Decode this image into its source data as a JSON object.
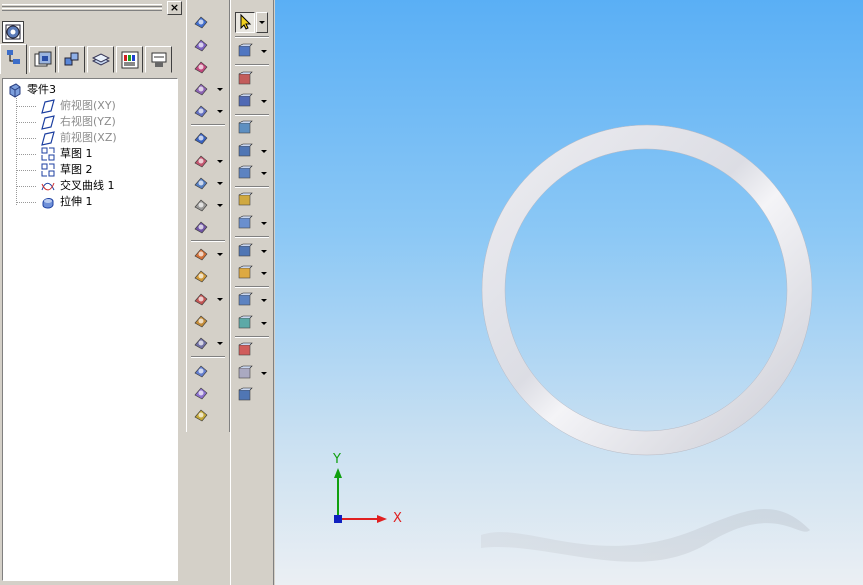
{
  "panel": {
    "close_label": "×",
    "tabs": [
      {
        "name": "feature-tree"
      },
      {
        "name": "properties"
      },
      {
        "name": "assembly"
      },
      {
        "name": "layers"
      },
      {
        "name": "render"
      },
      {
        "name": "display"
      }
    ]
  },
  "tree": {
    "root": "零件3",
    "items": [
      {
        "label": "俯视图(XY)",
        "icon": "plane-icon",
        "disabled": true
      },
      {
        "label": "右视图(YZ)",
        "icon": "plane-icon",
        "disabled": true
      },
      {
        "label": "前视图(XZ)",
        "icon": "plane-icon",
        "disabled": true
      },
      {
        "label": "草图 1",
        "icon": "sketch-icon",
        "disabled": false
      },
      {
        "label": "草图 2",
        "icon": "sketch-icon",
        "disabled": false
      },
      {
        "label": "交叉曲线 1",
        "icon": "intersect-curve-icon",
        "disabled": false
      },
      {
        "label": "拉伸 1",
        "icon": "extrude-icon",
        "disabled": false
      }
    ]
  },
  "viewport": {
    "axis_x": "X",
    "axis_y": "Y",
    "colors": {
      "x_axis": "#e02020",
      "y_axis": "#10a010",
      "z_axis": "#1020c0"
    }
  }
}
